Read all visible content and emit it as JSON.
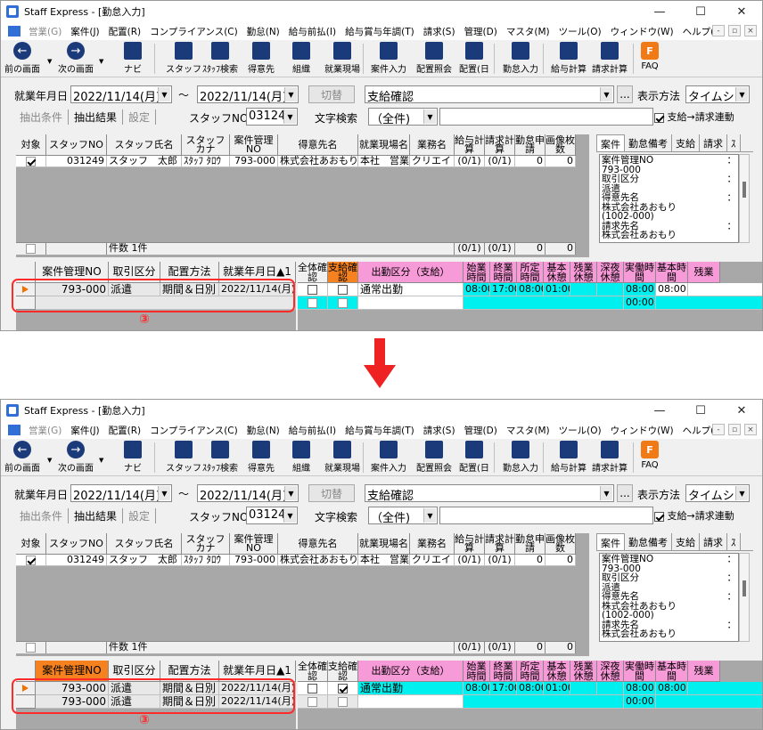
{
  "window": {
    "title": "Staff Express - [勤怠入力]"
  },
  "menu": [
    "営業(G)",
    "案件(J)",
    "配置(R)",
    "コンプライアンス(C)",
    "勤怠(N)",
    "給与前払(I)",
    "給与賞与年調(T)",
    "請求(S)",
    "管理(D)",
    "マスタ(M)",
    "ツール(O)",
    "ウィンドウ(W)",
    "ヘルプ(H)"
  ],
  "toolbar": {
    "prev": "前の画面",
    "next": "次の画面",
    "navi": "ナビ",
    "staff": "スタッフ",
    "staff_search": "ｽﾀｯﾌ検索",
    "client": "得意先",
    "org": "組織",
    "site": "就業現場",
    "case_input": "案件入力",
    "assign_ref": "配置照会",
    "assign_day": "配置(日",
    "attendance_input": "勤怠入力",
    "pay_calc": "給与計算",
    "bill_calc": "請求計算",
    "faq": "FAQ"
  },
  "filter": {
    "date_label": "就業年月日",
    "date_from": "2022/11/14(月)",
    "tilde": "～",
    "date_to": "2022/11/14(月)",
    "switch_btn": "切替",
    "mode": "支給確認",
    "ellipsis": "...",
    "display_label": "表示方法",
    "display_value": "タイムシ",
    "staff_no_label": "スタッフNO",
    "staff_no": "031249",
    "text_search_label": "文字検索",
    "text_search_value": "（全件)",
    "link_label": "支給→請求連動",
    "link_checked": true
  },
  "tabs": {
    "extract_cond": "抽出条件",
    "extract_result": "抽出結果",
    "settings": "設定"
  },
  "grid": {
    "headers": [
      "対象",
      "スタッフNO",
      "スタッフ氏名",
      "スタッフカナ",
      "案件管理NO",
      "得意先名",
      "就業現場名",
      "業務名",
      "給与計算",
      "請求計算",
      "勤怠申請",
      "画像枚数"
    ],
    "row": {
      "checked": true,
      "staff_no": "031249",
      "name": "スタッフ　太郎",
      "kana": "ｽﾀｯﾌ ﾀﾛｳ",
      "case_no": "793-000",
      "client": "株式会社あおもり",
      "site": "本社　営業",
      "job": "クリエイ",
      "pay": "(0/1)",
      "bill": "(0/1)",
      "req": "0",
      "img": "0"
    },
    "footer": {
      "count": "件数 1件",
      "pay": "(0/1)",
      "bill": "(0/1)",
      "req": "0",
      "img": "0"
    }
  },
  "side": {
    "tabs": [
      "案件",
      "勤怠備考",
      "支給",
      "請求",
      "ｽ"
    ],
    "lines": [
      "案件管理NO",
      "793-000",
      "取引区分",
      "派遣",
      "得意先名",
      "株式会社あおもり",
      "(1002-000)",
      "請求先名",
      "株式会社あおもり"
    ],
    "colons": [
      "：",
      "",
      "：",
      "",
      "：",
      "",
      "",
      "：",
      ""
    ]
  },
  "lower": {
    "left_headers": [
      "案件管理NO",
      "取引区分",
      "配置方法",
      "就業年月日▲1"
    ],
    "right_headers": [
      "全体確認",
      "支給確認",
      "出勤区分（支給）",
      "始業時間",
      "終業時間",
      "所定時間",
      "基本休憩",
      "残業休憩",
      "深夜休憩",
      "実働時間",
      "基本時間",
      "残業"
    ],
    "before": {
      "rows": [
        {
          "case_no": "793-000",
          "type": "派遣",
          "method": "期間＆日別",
          "date": "2022/11/14(月)"
        }
      ],
      "detail": {
        "attend": "通常出勤",
        "start": "08:00",
        "end": "17:00",
        "fixed": "08:00",
        "base_break": "01:00",
        "actual": "08:00",
        "base_time": "08:00",
        "actual2": "00:00"
      }
    },
    "after": {
      "rows": [
        {
          "case_no": "793-000",
          "type": "派遣",
          "method": "期間＆日別",
          "date": "2022/11/14(月)"
        },
        {
          "case_no": "793-000",
          "type": "派遣",
          "method": "期間＆日別",
          "date": "2022/11/14(月)"
        }
      ],
      "detail": {
        "attend": "通常出勤",
        "start": "08:00",
        "end": "17:00",
        "fixed": "08:00",
        "base_break": "01:00",
        "actual": "08:00",
        "base_time": "08:00",
        "actual2": "00:00"
      }
    }
  },
  "annotation": "③",
  "colors": {
    "arrow": "#ee2222",
    "highlight_box": "#ff2a2a",
    "orange_header": "#f5821f",
    "pink_header": "#f79ad8",
    "cyan_cell": "#00f0f0"
  }
}
